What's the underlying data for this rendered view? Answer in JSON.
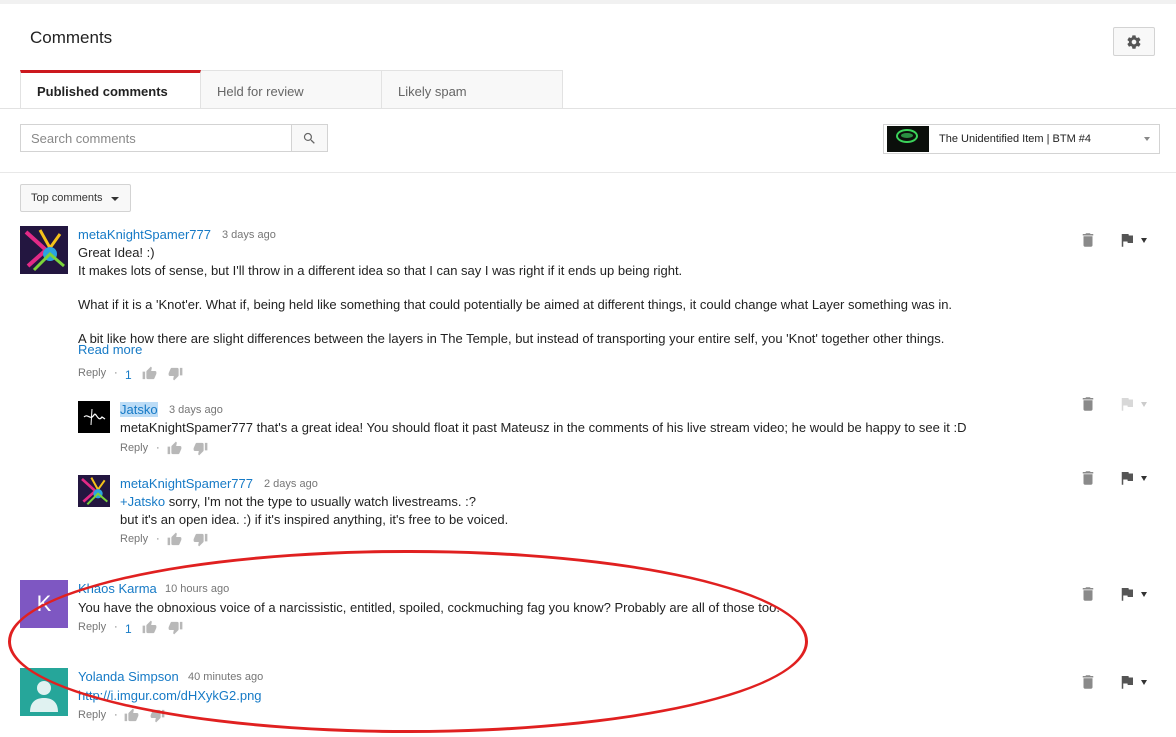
{
  "header": {
    "title": "Comments"
  },
  "tabs": [
    {
      "label": "Published comments"
    },
    {
      "label": "Held for review"
    },
    {
      "label": "Likely spam"
    }
  ],
  "search": {
    "placeholder": "Search comments"
  },
  "video": {
    "title": "The Unidentified Item | BTM #4"
  },
  "sort": {
    "label": "Top comments"
  },
  "comments": [
    {
      "author": "metaKnightSpamer777",
      "time": "3 days ago",
      "lines": [
        "Great Idea! :)",
        "It makes lots of sense, but I'll throw in a different idea so that I can say I was right if it ends up being right.",
        "What if it is a 'Knot'er. What if, being held like something that could potentially be aimed at different things, it could change what Layer something was in.",
        "A bit like how there are slight differences between the layers in The Temple, but instead of transporting your entire self, you 'Knot' together other things."
      ],
      "read_more": "Read more",
      "reply": "Reply",
      "likes": "1"
    },
    {
      "author": "Jatsko",
      "time": "3 days ago",
      "lines": [
        "metaKnightSpamer777 that's a great idea! You should float it past Mateusz in the comments of his live stream video; he would be happy to see it :D"
      ],
      "reply": "Reply"
    },
    {
      "author": "metaKnightSpamer777",
      "time": "2 days ago",
      "mention": "+Jatsko",
      "lines": [
        " sorry, I'm not the type to usually watch livestreams. :?",
        "but it's an open idea. :) if it's inspired anything, it's free to be voiced."
      ],
      "reply": "Reply"
    },
    {
      "author": "Khaos Karma",
      "initial": "K",
      "time": "10 hours ago",
      "lines": [
        "You have the obnoxious voice of a narcissistic, entitled, spoiled, cockmuching fag you know? Probably are all of those too."
      ],
      "reply": "Reply",
      "likes": "1"
    },
    {
      "author": "Yolanda Simpson",
      "time": "40 minutes ago",
      "link": "http://i.imgur.com/dHXykG2.png",
      "reply": "Reply"
    }
  ],
  "colors": {
    "accent": "#cc181e",
    "link": "#167ac6",
    "annotation": "#e02020"
  }
}
